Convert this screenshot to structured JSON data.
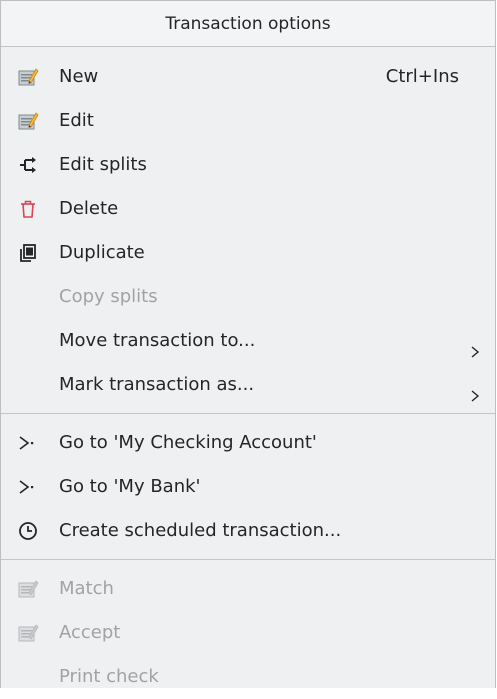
{
  "menu": {
    "title": "Transaction options",
    "group1": [
      {
        "label": "New",
        "shortcut": "Ctrl+Ins",
        "icon": "new-transaction-icon",
        "enabled": true
      },
      {
        "label": "Edit",
        "icon": "edit-transaction-icon",
        "enabled": true
      },
      {
        "label": "Edit splits",
        "icon": "split-icon",
        "enabled": true
      },
      {
        "label": "Delete",
        "icon": "trash-icon",
        "enabled": true
      },
      {
        "label": "Duplicate",
        "icon": "duplicate-icon",
        "enabled": true
      },
      {
        "label": "Copy splits",
        "enabled": false
      },
      {
        "label": "Move transaction to...",
        "submenu": true,
        "enabled": true
      },
      {
        "label": "Mark transaction as...",
        "submenu": true,
        "enabled": true
      }
    ],
    "group2": [
      {
        "label": "Go to 'My Checking Account'",
        "icon": "goto-icon",
        "enabled": true
      },
      {
        "label": "Go to 'My Bank'",
        "icon": "goto-icon",
        "enabled": true
      },
      {
        "label": "Create scheduled transaction...",
        "icon": "clock-icon",
        "enabled": true
      }
    ],
    "group3": [
      {
        "label": "Match",
        "icon": "match-icon",
        "enabled": false
      },
      {
        "label": "Accept",
        "icon": "accept-icon",
        "enabled": false
      },
      {
        "label": "Print check",
        "enabled": false
      }
    ]
  },
  "colors": {
    "menu_background": "#eff0f1",
    "text": "#232629",
    "disabled_text": "#a0a3a6",
    "delete_icon": "#da4453",
    "separator": "#c3c5c7"
  }
}
